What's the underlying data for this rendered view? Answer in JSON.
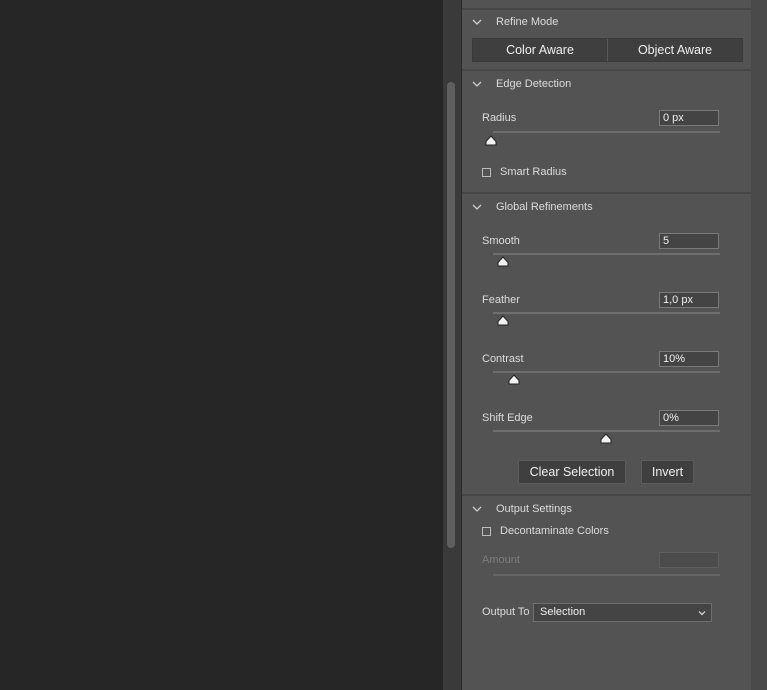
{
  "sections": {
    "refine_mode": {
      "title": "Refine Mode",
      "options": [
        "Color Aware",
        "Object Aware"
      ]
    },
    "edge_detection": {
      "title": "Edge Detection",
      "radius": {
        "label": "Radius",
        "value": "0 px",
        "slider_percent": 0
      },
      "smart_radius": {
        "label": "Smart Radius",
        "checked": false
      }
    },
    "global_refinements": {
      "title": "Global Refinements",
      "smooth": {
        "label": "Smooth",
        "value": "5",
        "slider_percent": 5
      },
      "feather": {
        "label": "Feather",
        "value": "1,0 px",
        "slider_percent": 5
      },
      "contrast": {
        "label": "Contrast",
        "value": "10%",
        "slider_percent": 10
      },
      "shift_edge": {
        "label": "Shift Edge",
        "value": "0%",
        "slider_percent": 50
      },
      "clear_selection_label": "Clear Selection",
      "invert_label": "Invert"
    },
    "output_settings": {
      "title": "Output Settings",
      "decontaminate": {
        "label": "Decontaminate Colors",
        "checked": false
      },
      "amount": {
        "label": "Amount",
        "value": ""
      },
      "output_to": {
        "label": "Output To",
        "value": "Selection"
      }
    }
  },
  "icons": {
    "collapse": "chevron-down-icon",
    "slider_thumb": "triangle-thumb-icon"
  },
  "colors": {
    "panel_bg": "#535353",
    "canvas_bg": "#262626",
    "button_bg": "#3f3f3f",
    "text": "#dcdcdc"
  }
}
